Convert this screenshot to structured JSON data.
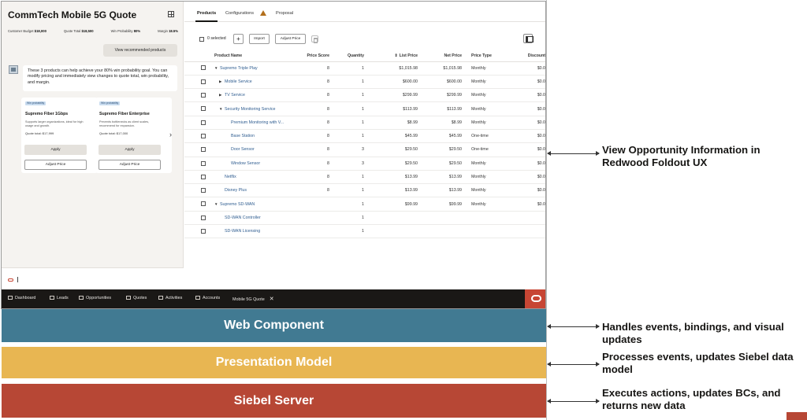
{
  "quote": {
    "title": "CommTech Mobile 5G Quote",
    "metrics": [
      {
        "label": "Customer Budget",
        "value": "$18,000"
      },
      {
        "label": "Quote Total",
        "value": "$18,500"
      },
      {
        "label": "Win Probability",
        "value": "80%"
      },
      {
        "label": "Margin",
        "value": "18.5%"
      }
    ],
    "view_recommended_label": "View recommended products"
  },
  "assistant": {
    "message": "These 3 products can help achieve your 80% win probability goal. You can modify pricing and immediately view changes to quote total, win probability, and margin."
  },
  "cards": [
    {
      "tag": "Win probability",
      "name": "Supremo Fiber 1Gbps",
      "desc": "Supports larger organizations, ideal for high usage and growth.",
      "total": "Quote total: $17,999",
      "apply": "Apply",
      "adjust": "Adjust Price"
    },
    {
      "tag": "Win probability",
      "name": "Supremo Fiber Enterprise",
      "desc": "Prevents bottlenecks as client scales, recommend for expansion.",
      "total": "Quote total: $17,000",
      "apply": "Apply",
      "adjust": "Adjust Price"
    }
  ],
  "tabs": [
    "Products",
    "Configurations",
    "Proposal"
  ],
  "toolbar": {
    "selected": "0 selected",
    "add": "+",
    "import": "Import",
    "adjust_price": "Adjust Price"
  },
  "table": {
    "headers": [
      "Product Name",
      "Price Score",
      "Quantity",
      "List Price",
      "Net Price",
      "Price Type",
      "Discount"
    ],
    "rows": [
      {
        "level": 0,
        "toggle": "▼",
        "name": "Supremo Triple Play",
        "score": "8",
        "qty": "1",
        "list": "$1,015.98",
        "net": "$1,015.98",
        "type": "Monthly",
        "disc": "$0.0"
      },
      {
        "level": 1,
        "toggle": "▶",
        "name": "Mobile Service",
        "score": "8",
        "qty": "1",
        "list": "$600.00",
        "net": "$600.00",
        "type": "Monthly",
        "disc": "$0.0"
      },
      {
        "level": 1,
        "toggle": "▶",
        "name": "TV Service",
        "score": "8",
        "qty": "1",
        "list": "$299.99",
        "net": "$299.99",
        "type": "Monthly",
        "disc": "$0.0"
      },
      {
        "level": 1,
        "toggle": "▼",
        "name": "Security Monitoring Service",
        "score": "8",
        "qty": "1",
        "list": "$113.99",
        "net": "$113.99",
        "type": "Monthly",
        "disc": "$0.0"
      },
      {
        "level": 2,
        "toggle": "",
        "name": "Premium Monitoring with V...",
        "score": "8",
        "qty": "1",
        "list": "$8.99",
        "net": "$8.99",
        "type": "Monthly",
        "disc": "$0.0"
      },
      {
        "level": 2,
        "toggle": "",
        "name": "Base Station",
        "score": "8",
        "qty": "1",
        "list": "$45.99",
        "net": "$45.99",
        "type": "One-time",
        "disc": "$0.0"
      },
      {
        "level": 2,
        "toggle": "",
        "name": "Door Sensor",
        "score": "8",
        "qty": "3",
        "list": "$29.50",
        "net": "$29.50",
        "type": "One-time",
        "disc": "$0.0"
      },
      {
        "level": 2,
        "toggle": "",
        "name": "Window Sensor",
        "score": "8",
        "qty": "3",
        "list": "$29.50",
        "net": "$29.50",
        "type": "Monthly",
        "disc": "$0.0"
      },
      {
        "level": 1,
        "toggle": "",
        "name": "Netflix",
        "score": "8",
        "qty": "1",
        "list": "$13.99",
        "net": "$13.99",
        "type": "Monthly",
        "disc": "$0.0"
      },
      {
        "level": 1,
        "toggle": "",
        "name": "Disney Plus",
        "score": "8",
        "qty": "1",
        "list": "$13.99",
        "net": "$13.99",
        "type": "Monthly",
        "disc": "$0.0"
      },
      {
        "level": 0,
        "toggle": "▼",
        "name": "Supremo SD-WAN",
        "score": "",
        "qty": "1",
        "list": "$99.99",
        "net": "$99.99",
        "type": "Monthly",
        "disc": "$0.0"
      },
      {
        "level": 1,
        "toggle": "",
        "name": "SD-WAN Controller",
        "score": "",
        "qty": "1",
        "list": "",
        "net": "",
        "type": "",
        "disc": ""
      },
      {
        "level": 1,
        "toggle": "",
        "name": "SD-WAN Licensing",
        "score": "",
        "qty": "1",
        "list": "",
        "net": "",
        "type": "",
        "disc": ""
      }
    ]
  },
  "taskbar": {
    "items": [
      "Dashboard",
      "Leads",
      "Opportunities",
      "Quotes",
      "Activities",
      "Accounts"
    ],
    "active": "Mobile 5G Quote",
    "close": "✕"
  },
  "layers": {
    "web_component": "Web Component",
    "presentation_model": "Presentation Model",
    "siebel_server": "Siebel Server"
  },
  "callouts": {
    "foldout": "View Opportunity Information in Redwood Foldout UX",
    "web": "Handles events, bindings, and visual updates",
    "pres": "Processes events, updates Siebel data model",
    "siebel": "Executes actions, updates BCs, and returns new data"
  },
  "colors": {
    "web_component": "#417a92",
    "presentation_model": "#e8b652",
    "siebel_server": "#b74735",
    "oracle_red": "#c74634",
    "link_blue": "#2f5d90"
  }
}
